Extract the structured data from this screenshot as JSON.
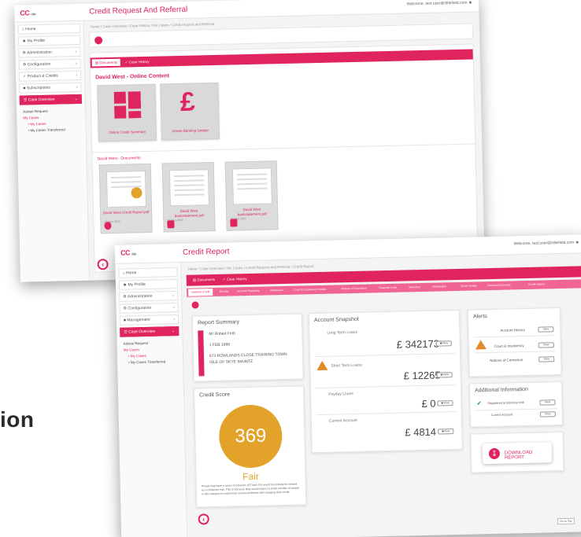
{
  "colors": {
    "accent": "#e0245e",
    "score": "#e3a32a",
    "warning": "#e38a2a"
  },
  "caption_fragment": "ion",
  "back_window": {
    "logo": "CC",
    "logo_sub": "data",
    "title": "Credit Request And Referral",
    "user": "Welcome, test.user@littlefield.com",
    "breadcrumb": "Home / Case Overview / Case History / My Cases / Credit request and Referral",
    "sidebar": [
      {
        "label": "Home",
        "icon": "home-icon"
      },
      {
        "label": "My Profile",
        "icon": "user-icon"
      },
      {
        "label": "Administration",
        "icon": "admin-icon"
      },
      {
        "label": "Configuration",
        "icon": "gear-icon"
      },
      {
        "label": "Product & Credits",
        "icon": "product-icon"
      },
      {
        "label": "Subscriptions",
        "icon": "subscription-icon"
      },
      {
        "label": "Case Overview",
        "icon": "list-icon"
      }
    ],
    "sidebar_sub": [
      "Advise Request",
      "My Cases",
      "My Cases",
      "My Cases Transferred"
    ],
    "tabs": [
      "Documents",
      "Case History"
    ],
    "section_title": "David West - Online Content",
    "tiles": [
      "Online Credit Summary",
      "Online Banking Update"
    ],
    "documents_title": "David West - Documents",
    "documents": [
      {
        "caption": "David West Credit Report.pdf",
        "date": "20 May 2019"
      },
      {
        "caption": "David West bankstatement.pdf",
        "date": "20 May 2019"
      },
      {
        "caption": "David West bankstatement.pdf",
        "date": "20 May 2019"
      }
    ]
  },
  "front_window": {
    "logo": "CC",
    "logo_sub": "data",
    "title": "Credit Report",
    "user": "Welcome, test.user@littlefield.com",
    "breadcrumb": "Home / Case Overview / My Cases / Credit Request and Referral / Credit Report",
    "sidebar": [
      {
        "label": "Home",
        "icon": "home-icon"
      },
      {
        "label": "My Profile",
        "icon": "user-icon"
      },
      {
        "label": "Administration",
        "icon": "admin-icon"
      },
      {
        "label": "Configuration",
        "icon": "gear-icon"
      },
      {
        "label": "Management",
        "icon": "management-icon"
      },
      {
        "label": "Case Overview",
        "icon": "list-icon"
      }
    ],
    "sidebar_sub": [
      "Advise Request",
      "My Cases",
      "My Cases",
      "My Cases Transferred"
    ],
    "top_tabs": [
      "Documents",
      "Case History"
    ],
    "report_tabs": [
      "Network Credit",
      "Bureau",
      "Account Summary",
      "Addresses",
      "Court & Insolvency Details",
      "Notices of Correction",
      "Financial Links",
      "Searches",
      "Attributable",
      "Score Details",
      "Historical Accounts",
      "Credit History"
    ],
    "report_summary": {
      "title": "Report Summary",
      "name": "Mr Robert Firth",
      "dob": "1 FEB 1986",
      "address_line1": "673 ROWLANDS CLOSE TRAINING TOWN",
      "address_line2": "ISLE OF SKYE WA48TZ"
    },
    "credit_score": {
      "title": "Credit Score",
      "score": "369",
      "rating": "Fair",
      "description": "People that have a score of between 267 and 414 would most likely be viewed as a moderate risk. This is because they would expect a small number of people in this category to experience severe problems with repaying their credit."
    },
    "account_snapshot": {
      "title": "Account Snapshot",
      "rows": [
        {
          "label": "Long Term Loans",
          "value": "£ 342173",
          "button": "View"
        },
        {
          "label": "Short Term Loans",
          "value": "£ 12265",
          "button": "View"
        },
        {
          "label": "Payday Loans",
          "value": "£ 0",
          "button": "View"
        },
        {
          "label": "Current Account",
          "value": "£ 4814",
          "button": "View"
        }
      ]
    },
    "alerts": {
      "title": "Alerts",
      "rows": [
        {
          "label": "Account History",
          "button": "View"
        },
        {
          "label": "Court & Insolvency",
          "button": "View"
        },
        {
          "label": "Notices of Correction",
          "button": "View"
        }
      ]
    },
    "additional_info": {
      "title": "Additional Information",
      "rows": [
        {
          "label": "Registered at Electoral Roll",
          "button": "View"
        },
        {
          "label": "Current Account",
          "button": "View"
        }
      ]
    },
    "download_label": "DOWNLOAD REPORT",
    "go_top": "Go to Top"
  }
}
